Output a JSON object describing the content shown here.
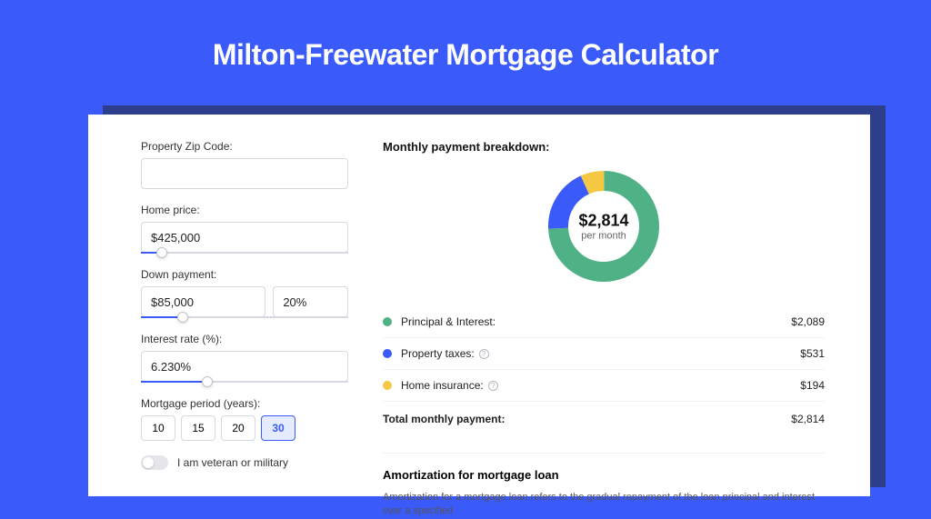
{
  "page": {
    "title": "Milton-Freewater Mortgage Calculator"
  },
  "form": {
    "zip_label": "Property Zip Code:",
    "zip_value": "",
    "price_label": "Home price:",
    "price_value": "$425,000",
    "down_label": "Down payment:",
    "down_value": "$85,000",
    "down_pct": "20%",
    "rate_label": "Interest rate (%):",
    "rate_value": "6.230%",
    "period_label": "Mortgage period (years):",
    "periods": [
      "10",
      "15",
      "20",
      "30"
    ],
    "period_selected": "30",
    "veteran_label": "I am veteran or military"
  },
  "breakdown": {
    "title": "Monthly payment breakdown:",
    "center_value": "$2,814",
    "center_sub": "per month",
    "rows": [
      {
        "label": "Principal & Interest:",
        "value": "$2,089",
        "color": "green",
        "info": false
      },
      {
        "label": "Property taxes:",
        "value": "$531",
        "color": "blue",
        "info": true
      },
      {
        "label": "Home insurance:",
        "value": "$194",
        "color": "yellow",
        "info": true
      }
    ],
    "total_label": "Total monthly payment:",
    "total_value": "$2,814"
  },
  "amort": {
    "title": "Amortization for mortgage loan",
    "text": "Amortization for a mortgage loan refers to the gradual repayment of the loan principal and interest over a specified"
  },
  "chart_data": {
    "type": "pie",
    "title": "Monthly payment breakdown",
    "series": [
      {
        "name": "Principal & Interest",
        "value": 2089,
        "color": "#4fb286"
      },
      {
        "name": "Property taxes",
        "value": 531,
        "color": "#3a5af9"
      },
      {
        "name": "Home insurance",
        "value": 194,
        "color": "#f5c844"
      }
    ],
    "total": 2814,
    "center_label": "$2,814 per month"
  }
}
